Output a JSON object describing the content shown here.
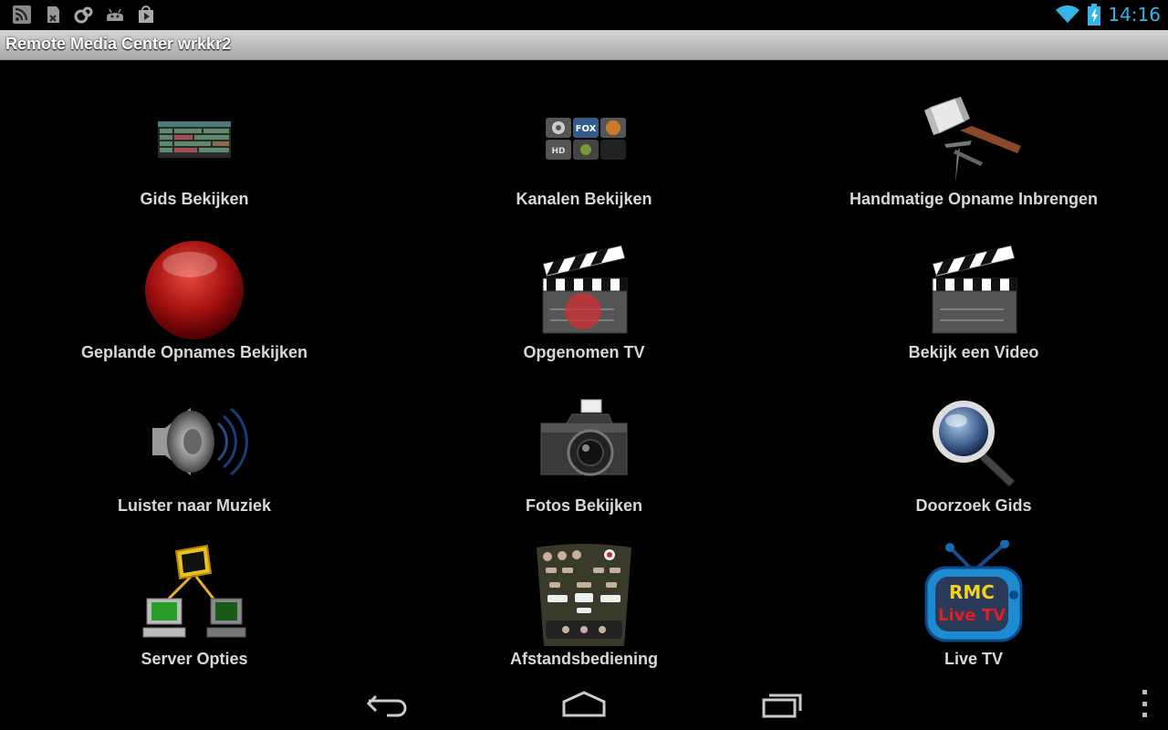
{
  "status_bar": {
    "time": "14:16",
    "left_icons": [
      "rss-icon",
      "evernote-icon",
      "sync-icon",
      "android-debug-icon",
      "play-store-icon"
    ],
    "accent_color": "#33b5e5"
  },
  "app": {
    "title": "Remote Media Center wrkkr2"
  },
  "menu": {
    "items": [
      {
        "label": "Gids Bekijken",
        "icon": "tv-guide-icon"
      },
      {
        "label": "Kanalen Bekijken",
        "icon": "channels-icon"
      },
      {
        "label": "Handmatige Opname Inbrengen",
        "icon": "hammer-icon"
      },
      {
        "label": "Geplande Opnames Bekijken",
        "icon": "record-icon"
      },
      {
        "label": "Opgenomen TV",
        "icon": "clapperboard-record-icon"
      },
      {
        "label": "Bekijk een Video",
        "icon": "clapperboard-icon"
      },
      {
        "label": "Luister naar Muziek",
        "icon": "speaker-icon"
      },
      {
        "label": "Fotos Bekijken",
        "icon": "camera-icon"
      },
      {
        "label": "Doorzoek Gids",
        "icon": "magnifier-icon"
      },
      {
        "label": "Server Opties",
        "icon": "network-icon"
      },
      {
        "label": "Afstandsbediening",
        "icon": "remote-control-icon"
      },
      {
        "label": "Live TV",
        "icon": "live-tv-icon"
      }
    ],
    "live_tv_badge_top": "RMC",
    "live_tv_badge_bottom": "Live TV"
  },
  "nav_bar": {
    "buttons": [
      "back-icon",
      "home-icon",
      "recent-apps-icon",
      "overflow-menu-icon"
    ]
  }
}
